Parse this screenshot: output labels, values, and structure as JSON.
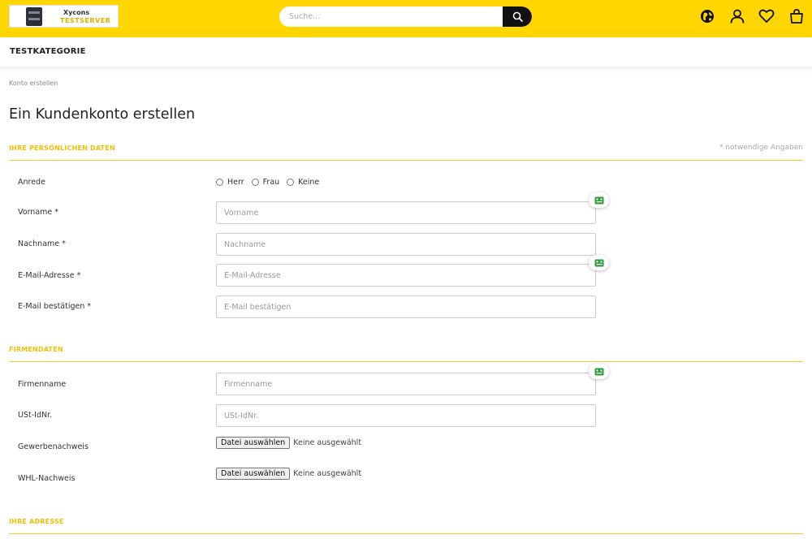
{
  "header": {
    "logo": {
      "line1": "Xycons",
      "line2": "TESTSERVER"
    },
    "search": {
      "placeholder": "Suche..."
    },
    "icons": [
      "globe-icon",
      "user-icon",
      "heart-icon",
      "bag-icon",
      "search-icon"
    ],
    "colors": {
      "bar": "#ffd600",
      "search_button": "#111111"
    }
  },
  "nav": {
    "items": [
      "TESTKATEGORIE"
    ]
  },
  "breadcrumb": "Konto erstellen",
  "page_title": "Ein Kundenkonto erstellen",
  "required_note": "* notwendige Angaben",
  "accent_color": "#f0c000",
  "sections": {
    "personal": {
      "title": "IHRE PERSÖNLICHEN DATEN",
      "salutation": {
        "label": "Anrede",
        "options": [
          "Herr",
          "Frau",
          "Keine"
        ]
      },
      "firstname": {
        "label": "Vorname *",
        "placeholder": "Vorname"
      },
      "lastname": {
        "label": "Nachname *",
        "placeholder": "Nachname"
      },
      "email": {
        "label": "E-Mail-Adresse *",
        "placeholder": "E-Mail-Adresse"
      },
      "email_confirm": {
        "label": "E-Mail bestätigen *",
        "placeholder": "E-Mail bestätigen"
      }
    },
    "company": {
      "title": "FIRMENDATEN",
      "company_name": {
        "label": "Firmenname",
        "placeholder": "Firmenname"
      },
      "vat_id": {
        "label": "USt-IdNr.",
        "placeholder": "USt-IdNr."
      },
      "trade_proof": {
        "label": "Gewerbenachweis",
        "button": "Datei auswählen",
        "status": "Keine ausgewählt"
      },
      "whl_proof": {
        "label": "WHL-Nachweis",
        "button": "Datei auswählen",
        "status": "Keine ausgewählt"
      }
    },
    "address": {
      "title": "IHRE ADRESSE"
    }
  }
}
